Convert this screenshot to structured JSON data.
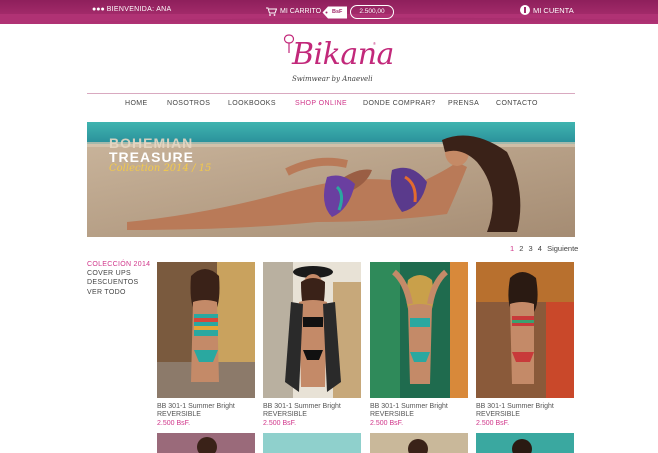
{
  "topbar": {
    "welcome": "BIENVENIDA: ANA",
    "cart_label": "MI CARRITO",
    "currency": "BsF",
    "cart_total": "2.500,00",
    "account_label": "MI CUENTA"
  },
  "logo": {
    "name": "Bikana",
    "reg": "®",
    "tagline": "Swimwear by Anaeveli"
  },
  "nav": [
    "HOME",
    "NOSOTROS",
    "LOOKBOOKS",
    "SHOP ONLINE",
    "DONDE COMPRAR?",
    "PRENSA",
    "CONTACTO"
  ],
  "nav_active": "SHOP ONLINE",
  "banner": {
    "line1": "BOHEMIAN",
    "line2": "TREASURE",
    "line3": "Collection 2014 / 15"
  },
  "pager": {
    "pages": [
      "1",
      "2",
      "3",
      "4"
    ],
    "current": "1",
    "next": "Siguiente"
  },
  "sidebar": [
    "COLECCIÓN 2014",
    "COVER UPS",
    "DESCUENTOS",
    "VER TODO"
  ],
  "products": [
    {
      "name1": "BB 301-1 Summer Bright",
      "name2": "REVERSIBLE",
      "price": "2.500 BsF."
    },
    {
      "name1": "BB 301-1 Summer Bright",
      "name2": "REVERSIBLE",
      "price": "2.500 BsF."
    },
    {
      "name1": "BB 301-1 Summer Bright",
      "name2": "REVERSIBLE",
      "price": "2.500 BsF."
    },
    {
      "name1": "BB 301-1 Summer Bright",
      "name2": "REVERSIBLE",
      "price": "2.500 BsF."
    }
  ],
  "colors": {
    "brand": "#c2287a",
    "topbar": "#a0286a",
    "accent": "#d0368a"
  }
}
